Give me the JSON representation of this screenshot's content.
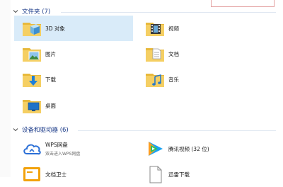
{
  "folders_group": {
    "title": "文件夹 (7)"
  },
  "folders": [
    {
      "label": "3D 对象",
      "icon": "3d-objects-folder-icon"
    },
    {
      "label": "视频",
      "icon": "videos-folder-icon"
    },
    {
      "label": "图片",
      "icon": "pictures-folder-icon"
    },
    {
      "label": "文档",
      "icon": "documents-folder-icon"
    },
    {
      "label": "下载",
      "icon": "downloads-folder-icon"
    },
    {
      "label": "音乐",
      "icon": "music-folder-icon"
    },
    {
      "label": "桌面",
      "icon": "desktop-folder-icon"
    }
  ],
  "devices_group": {
    "title": "设备和驱动器 (6)"
  },
  "devices": [
    {
      "label": "WPS网盘",
      "sub": "双击进入WPS网盘",
      "icon": "wps-cloud-icon"
    },
    {
      "label": "腾讯视频 (32 位)",
      "sub": "",
      "icon": "tencent-video-icon"
    },
    {
      "label": "文档卫士",
      "sub": "",
      "icon": "doc-guard-icon"
    },
    {
      "label": "迅雷下载",
      "sub": "",
      "icon": "xunlei-download-icon"
    }
  ],
  "colors": {
    "folder": "#f2c94c",
    "selection": "#d9ebf9",
    "header_text": "#1e3d8a"
  }
}
